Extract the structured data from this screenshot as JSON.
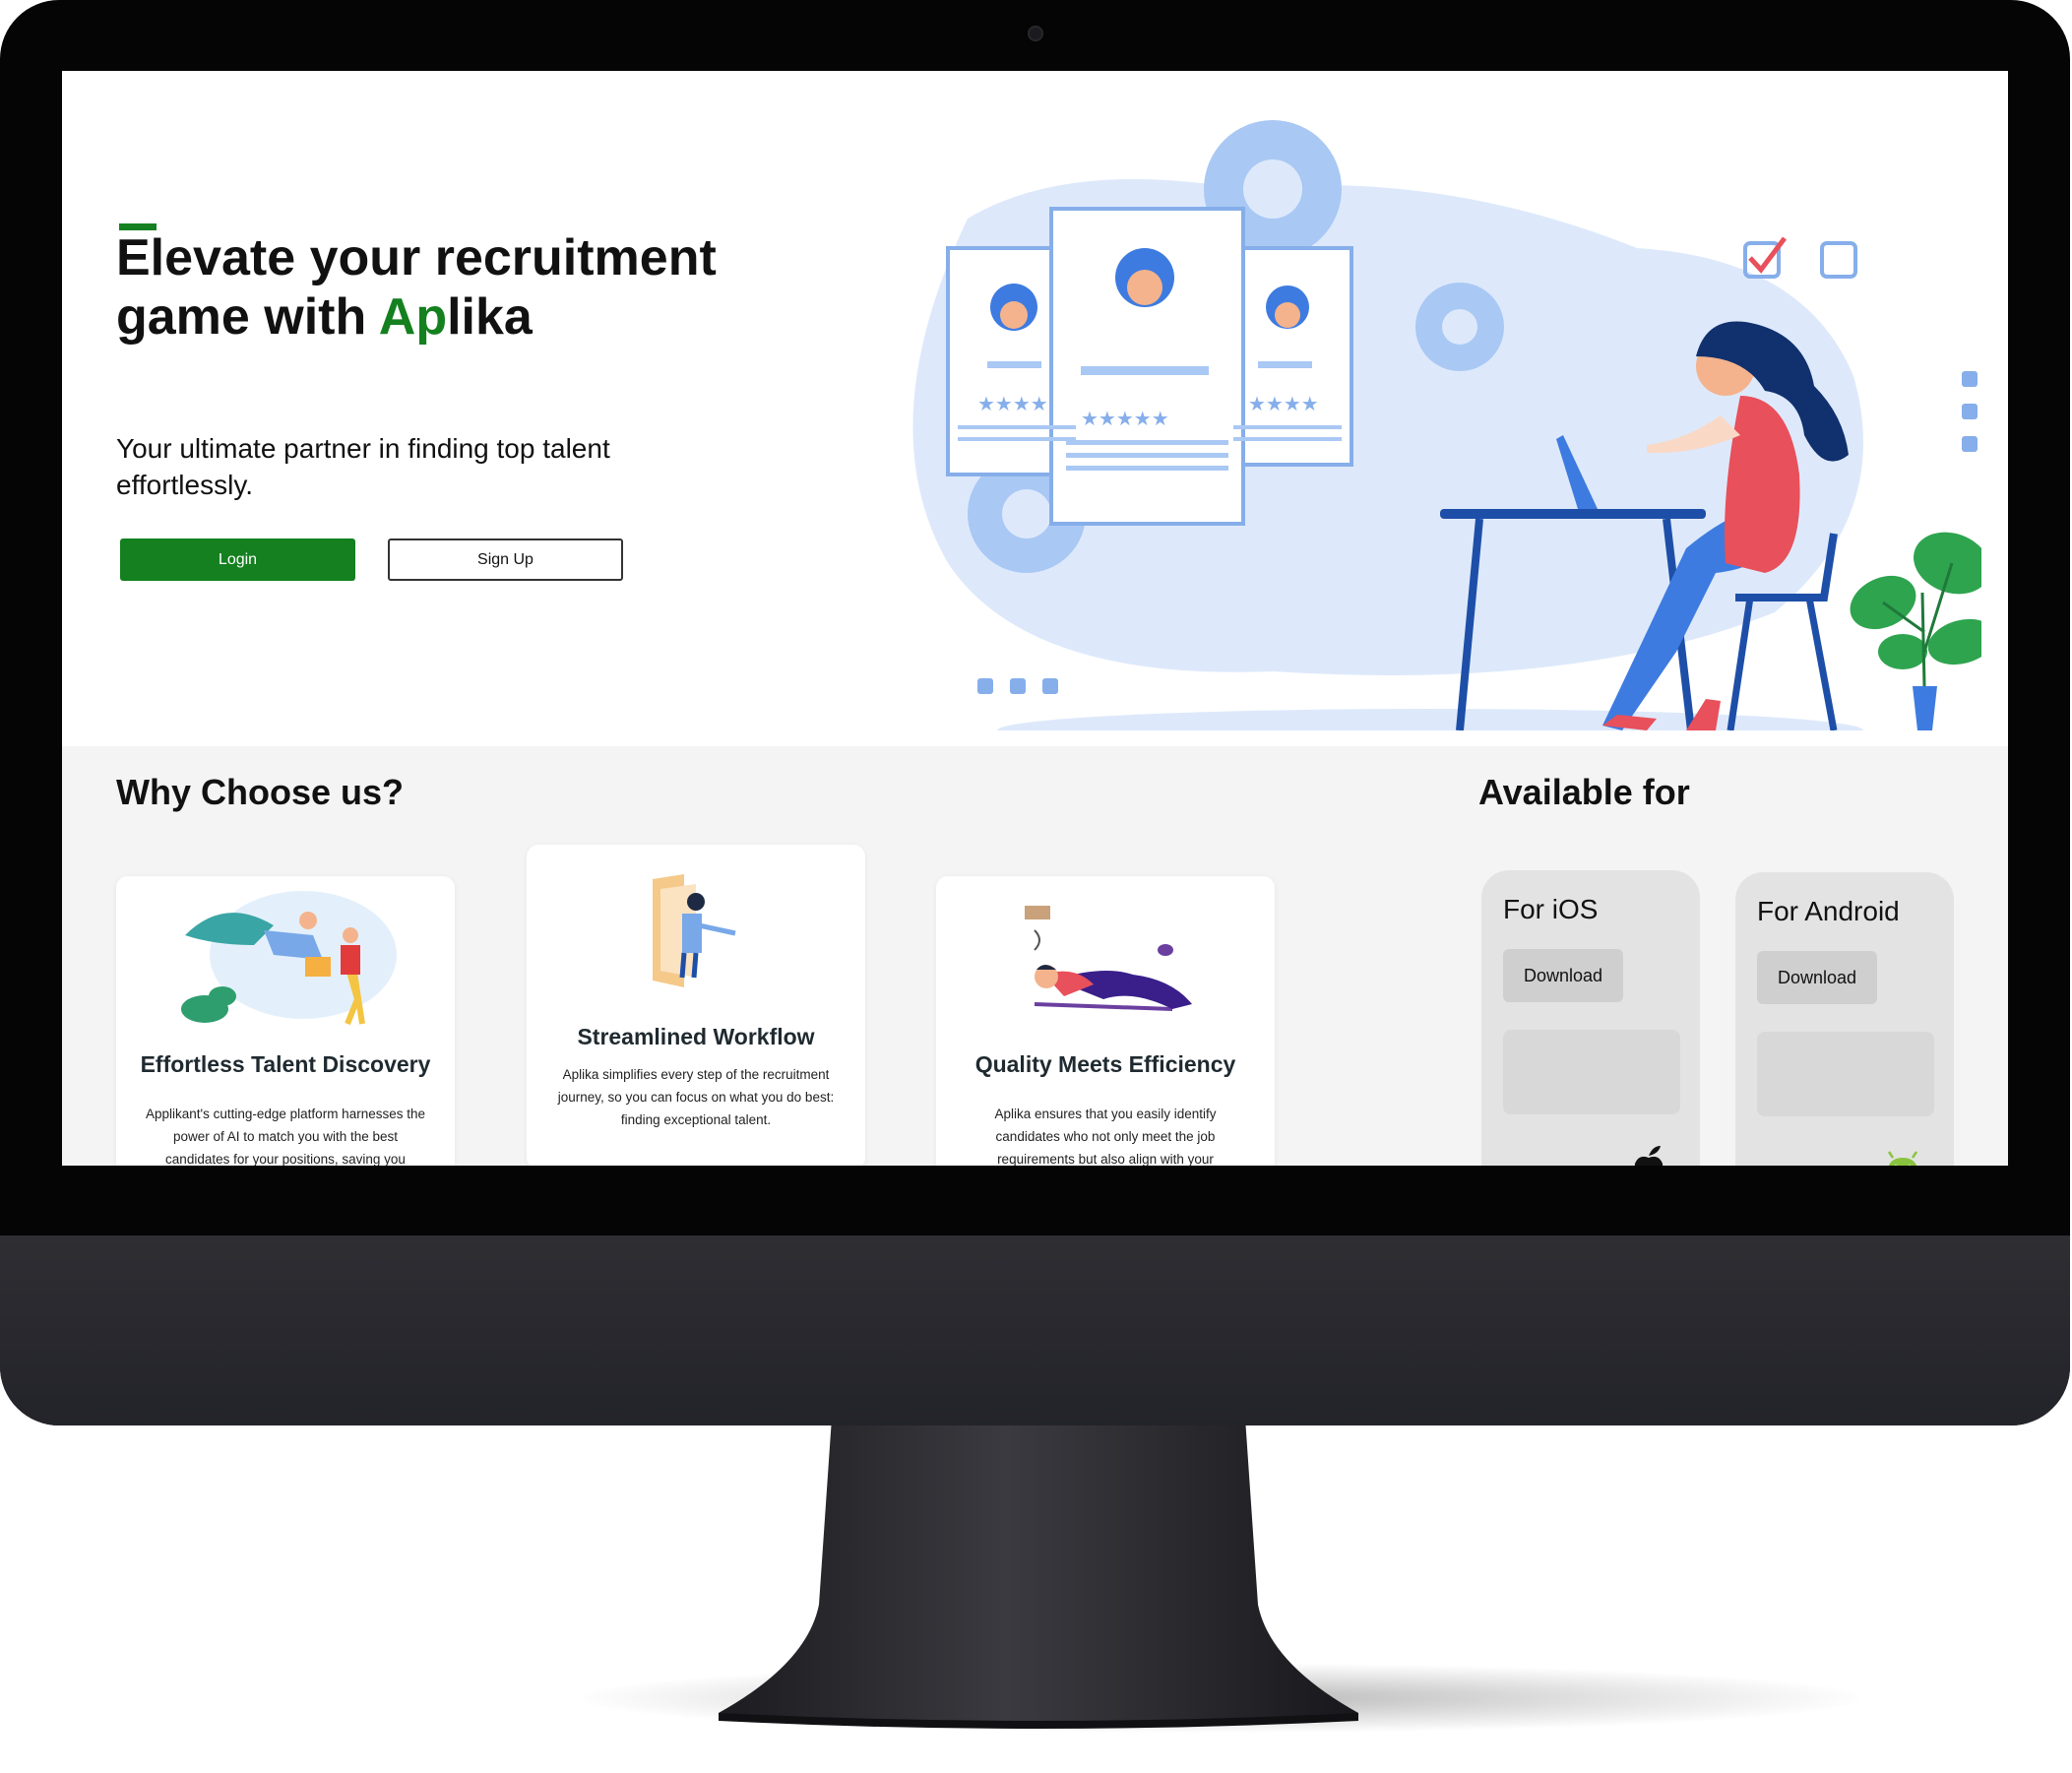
{
  "hero": {
    "headline_part1": "Elevate your recruitment game with ",
    "brand_part1": "Ap",
    "brand_part2": "lika",
    "subline": "Your ultimate partner in finding top talent effortlessly.",
    "login_label": "Login",
    "signup_label": "Sign Up"
  },
  "why": {
    "title": "Why Choose us?",
    "cards": [
      {
        "title": "Effortless Talent Discovery",
        "desc": "Applikant's cutting-edge platform harnesses the power of AI to match you with the best candidates for your positions, saving you",
        "icon": "superhero-delivery-illustration"
      },
      {
        "title": "Streamlined Workflow",
        "desc": "Aplika simplifies every step of the recruitment journey, so you can focus on what you do best: finding exceptional talent.",
        "icon": "person-in-frame-illustration"
      },
      {
        "title": "Quality Meets Efficiency",
        "desc": "Aplika ensures that you easily identify candidates who not only meet the job requirements but also align with your",
        "icon": "relaxing-person-illustration"
      }
    ]
  },
  "available": {
    "title": "Available for",
    "platforms": [
      {
        "name": "For iOS",
        "button": "Download",
        "icon": "apple-icon"
      },
      {
        "name": "For Android",
        "button": "Download",
        "icon": "android-icon"
      }
    ]
  },
  "colors": {
    "brand_green": "#14801f",
    "illustration_blue": "#3e7be0",
    "section_bg": "#f4f4f4"
  }
}
